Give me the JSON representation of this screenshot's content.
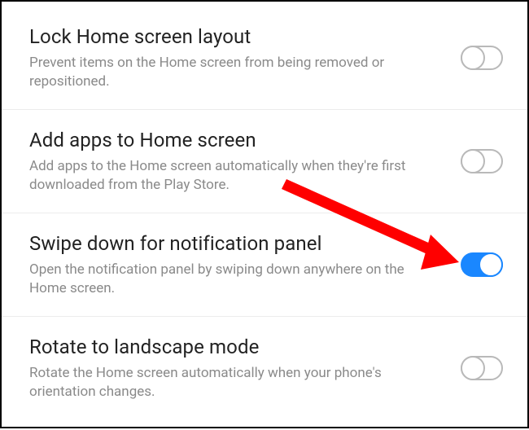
{
  "settings": [
    {
      "title": "Lock Home screen layout",
      "desc": "Prevent items on the Home screen from being removed or repositioned.",
      "on": false
    },
    {
      "title": "Add apps to Home screen",
      "desc": "Add apps to the Home screen automatically when they're first downloaded from the Play Store.",
      "on": false
    },
    {
      "title": "Swipe down for notification panel",
      "desc": "Open the notification panel by swiping down anywhere on the Home screen.",
      "on": true
    },
    {
      "title": "Rotate to landscape mode",
      "desc": "Rotate the Home screen automatically when your phone's orientation changes.",
      "on": false
    }
  ]
}
